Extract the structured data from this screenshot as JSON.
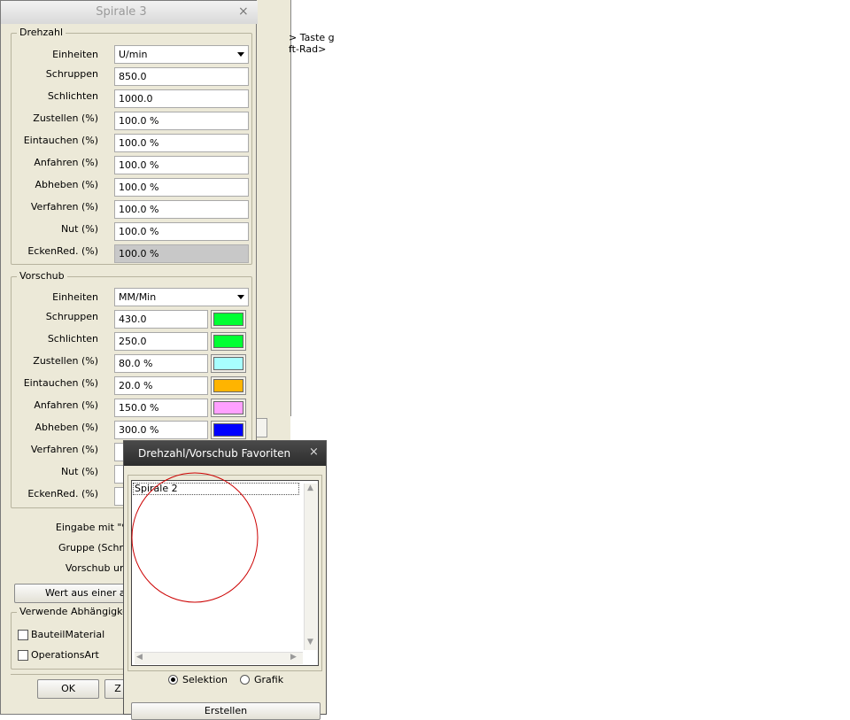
{
  "background_window": {
    "text_line1": "> Taste g",
    "text_line2": "ft-Rad>"
  },
  "main_dialog": {
    "title": "Spirale 3",
    "close": "×",
    "drehzahl": {
      "group_title": "Drehzahl",
      "einheiten_label": "Einheiten",
      "einheiten_value": "U/min",
      "rows": [
        {
          "label": "Schruppen",
          "value": "850.0"
        },
        {
          "label": "Schlichten",
          "value": "1000.0"
        },
        {
          "label": "Zustellen (%)",
          "value": "100.0 %"
        },
        {
          "label": "Eintauchen (%)",
          "value": "100.0 %"
        },
        {
          "label": "Anfahren (%)",
          "value": "100.0 %"
        },
        {
          "label": "Abheben (%)",
          "value": "100.0 %"
        },
        {
          "label": "Verfahren (%)",
          "value": "100.0 %"
        },
        {
          "label": "Nut (%)",
          "value": "100.0 %"
        },
        {
          "label": "EckenRed. (%)",
          "value": "100.0 %"
        }
      ]
    },
    "vorschub": {
      "group_title": "Vorschub",
      "einheiten_label": "Einheiten",
      "einheiten_value": "MM/Min",
      "rows": [
        {
          "label": "Schruppen",
          "value": "430.0",
          "color": "#00ff33"
        },
        {
          "label": "Schlichten",
          "value": "250.0",
          "color": "#00ff33"
        },
        {
          "label": "Zustellen (%)",
          "value": "80.0 %",
          "color": "#a8ffff"
        },
        {
          "label": "Eintauchen (%)",
          "value": "20.0 %",
          "color": "#ffb400"
        },
        {
          "label": "Anfahren (%)",
          "value": "150.0 %",
          "color": "#ffa0ff"
        },
        {
          "label": "Abheben (%)",
          "value": "300.0 %",
          "color": "#0000ff"
        },
        {
          "label": "Verfahren (%)"
        },
        {
          "label": "Nut (%)"
        },
        {
          "label": "EckenRed. (%)"
        }
      ]
    },
    "eingabe_text": "Eingabe mit \"%\"",
    "gruppe_text": "Gruppe (Schrup",
    "vorschub_text": "Vorschub unte",
    "wert_button": "Wert aus einer an",
    "abh_group_title": "Verwende Abhängigkeite",
    "checkboxes": [
      {
        "label": "BauteilMaterial"
      },
      {
        "label": "OperationsArt"
      }
    ],
    "ok_button": "OK",
    "z_button": "Z"
  },
  "favorites_dialog": {
    "title": "Drehzahl/Vorschub Favoriten",
    "close": "×",
    "list_items": [
      "Spirale 2"
    ],
    "radio_selektion": "Selektion",
    "radio_grafik": "Grafik",
    "erstellen_button": "Erstellen",
    "annotation_color": "#cc0000"
  }
}
